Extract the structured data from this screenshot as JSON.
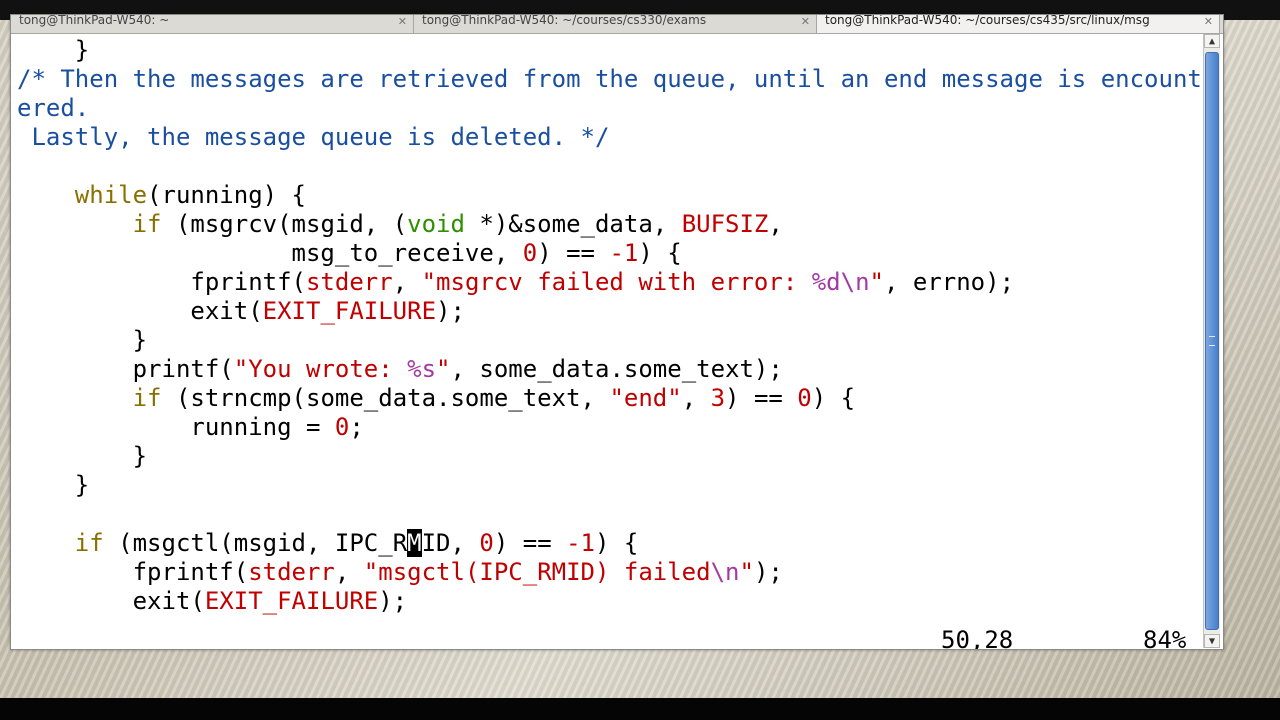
{
  "window": {
    "tabs": [
      {
        "label": "tong@ThinkPad-W540: ~",
        "active": false
      },
      {
        "label": "tong@ThinkPad-W540: ~/courses/cs330/exams",
        "active": false
      },
      {
        "label": "tong@ThinkPad-W540: ~/courses/cs435/src/linux/msg",
        "active": true
      }
    ],
    "close_glyph": "✕"
  },
  "editor": {
    "lines": [
      [
        {
          "t": "    }",
          "k": "n"
        }
      ],
      [
        {
          "t": "/* Then the messages are retrieved from the queue, until an end message is encount",
          "k": "comment"
        }
      ],
      [
        {
          "t": "ered.",
          "k": "comment"
        }
      ],
      [
        {
          "t": " Lastly, the message queue is deleted. */",
          "k": "comment"
        }
      ],
      [
        {
          "t": "",
          "k": "n"
        }
      ],
      [
        {
          "t": "    ",
          "k": "n"
        },
        {
          "t": "while",
          "k": "keyword"
        },
        {
          "t": "(running) {",
          "k": "n"
        }
      ],
      [
        {
          "t": "        ",
          "k": "n"
        },
        {
          "t": "if",
          "k": "keyword"
        },
        {
          "t": " (msgrcv(msgid, (",
          "k": "n"
        },
        {
          "t": "void",
          "k": "type"
        },
        {
          "t": " *)&some_data, ",
          "k": "n"
        },
        {
          "t": "BUFSIZ",
          "k": "const"
        },
        {
          "t": ",",
          "k": "n"
        }
      ],
      [
        {
          "t": "                   msg_to_receive, ",
          "k": "n"
        },
        {
          "t": "0",
          "k": "number"
        },
        {
          "t": ") == ",
          "k": "n"
        },
        {
          "t": "-1",
          "k": "number"
        },
        {
          "t": ") {",
          "k": "n"
        }
      ],
      [
        {
          "t": "            fprintf(",
          "k": "n"
        },
        {
          "t": "stderr",
          "k": "const"
        },
        {
          "t": ", ",
          "k": "n"
        },
        {
          "t": "\"msgrcv failed with error: ",
          "k": "string"
        },
        {
          "t": "%d\\n",
          "k": "special"
        },
        {
          "t": "\"",
          "k": "string"
        },
        {
          "t": ", errno);",
          "k": "n"
        }
      ],
      [
        {
          "t": "            exit(",
          "k": "n"
        },
        {
          "t": "EXIT_FAILURE",
          "k": "const"
        },
        {
          "t": ");",
          "k": "n"
        }
      ],
      [
        {
          "t": "        }",
          "k": "n"
        }
      ],
      [
        {
          "t": "        printf(",
          "k": "n"
        },
        {
          "t": "\"You wrote: ",
          "k": "string"
        },
        {
          "t": "%s",
          "k": "special"
        },
        {
          "t": "\"",
          "k": "string"
        },
        {
          "t": ", some_data.some_text);",
          "k": "n"
        }
      ],
      [
        {
          "t": "        ",
          "k": "n"
        },
        {
          "t": "if",
          "k": "keyword"
        },
        {
          "t": " (strncmp(some_data.some_text, ",
          "k": "n"
        },
        {
          "t": "\"end\"",
          "k": "string"
        },
        {
          "t": ", ",
          "k": "n"
        },
        {
          "t": "3",
          "k": "number"
        },
        {
          "t": ") == ",
          "k": "n"
        },
        {
          "t": "0",
          "k": "number"
        },
        {
          "t": ") {",
          "k": "n"
        }
      ],
      [
        {
          "t": "            running = ",
          "k": "n"
        },
        {
          "t": "0",
          "k": "number"
        },
        {
          "t": ";",
          "k": "n"
        }
      ],
      [
        {
          "t": "        }",
          "k": "n"
        }
      ],
      [
        {
          "t": "    }",
          "k": "n"
        }
      ],
      [
        {
          "t": "",
          "k": "n"
        }
      ],
      [
        {
          "t": "    ",
          "k": "n"
        },
        {
          "t": "if",
          "k": "keyword"
        },
        {
          "t": " (msgctl(msgid, IPC_R",
          "k": "n"
        },
        {
          "t": "M",
          "k": "cursor"
        },
        {
          "t": "ID, ",
          "k": "n"
        },
        {
          "t": "0",
          "k": "number"
        },
        {
          "t": ") == ",
          "k": "n"
        },
        {
          "t": "-1",
          "k": "number"
        },
        {
          "t": ") {",
          "k": "n"
        }
      ],
      [
        {
          "t": "        fprintf(",
          "k": "n"
        },
        {
          "t": "stderr",
          "k": "const"
        },
        {
          "t": ", ",
          "k": "n"
        },
        {
          "t": "\"msgctl(IPC_RMID) failed",
          "k": "string"
        },
        {
          "t": "\\n",
          "k": "special"
        },
        {
          "t": "\"",
          "k": "string"
        },
        {
          "t": ");",
          "k": "n"
        }
      ],
      [
        {
          "t": "        exit(",
          "k": "n"
        },
        {
          "t": "EXIT_FAILURE",
          "k": "const"
        },
        {
          "t": ");",
          "k": "n"
        }
      ]
    ]
  },
  "status": {
    "position": "50,28",
    "percent": "84%"
  },
  "scrollbar": {
    "up_glyph": "▲",
    "down_glyph": "▼",
    "position_percent": 84
  },
  "colors": {
    "comment": "#1a4fa0",
    "keyword": "#8a7000",
    "type": "#2f8f00",
    "constant": "#c00000",
    "special": "#a33aa3",
    "scroll_thumb": "#5b8fd6"
  }
}
